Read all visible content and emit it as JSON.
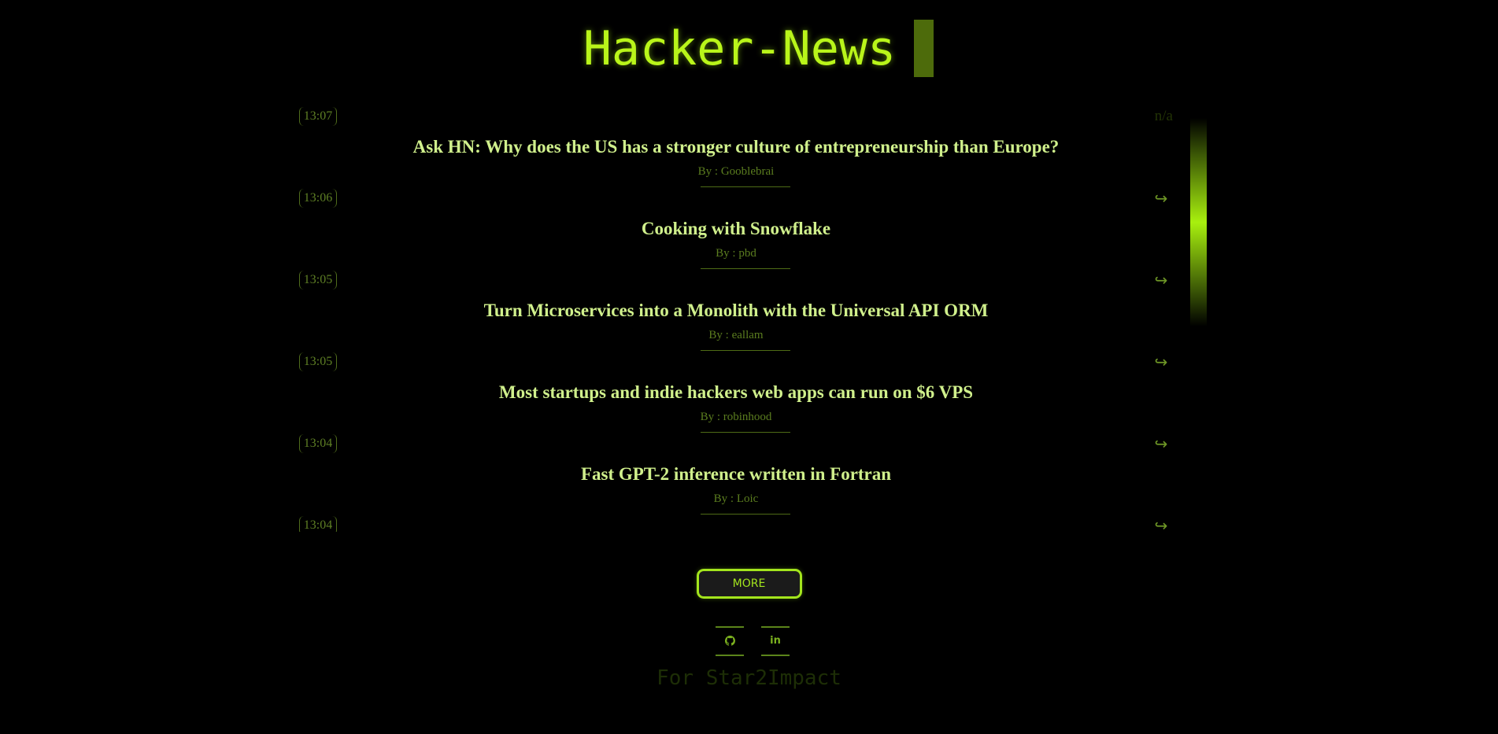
{
  "header": {
    "title": "Hacker-News"
  },
  "stories": [
    {
      "time": "13:07",
      "share": "n/a",
      "title": "Ask HN: Why does the US has a stronger culture of entrepreneurship than Europe?",
      "author": "By : Gooblebrai"
    },
    {
      "time": "13:06",
      "share": "↪",
      "title": "Cooking with Snowflake",
      "author": "By : pbd"
    },
    {
      "time": "13:05",
      "share": "↪",
      "title": "Turn Microservices into a Monolith with the Universal API ORM",
      "author": "By : eallam"
    },
    {
      "time": "13:05",
      "share": "↪",
      "title": "Most startups and indie hackers web apps can run on $6 VPS",
      "author": "By : robinhood"
    },
    {
      "time": "13:04",
      "share": "↪",
      "title": "Fast GPT-2 inference written in Fortran",
      "author": "By : Loic"
    },
    {
      "time": "13:04",
      "share": "↪",
      "title": "",
      "author": ""
    }
  ],
  "more_button": {
    "label": "MORE"
  },
  "social": {
    "github_icon": "github-icon",
    "github_glyph": "",
    "linkedin_icon": "linkedin-icon",
    "linkedin_glyph": "in"
  },
  "footer": {
    "note": "For Star2Impact"
  },
  "colors": {
    "background": "#000000",
    "accent": "#b9f51a",
    "title_text": "#d0f08c",
    "muted": "#5b7d1f"
  }
}
